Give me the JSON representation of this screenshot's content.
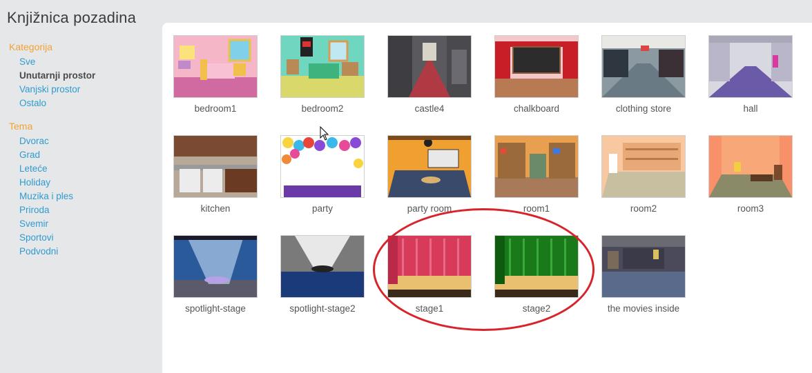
{
  "title": "Knjižnica pozadina",
  "sidebar": {
    "category_heading": "Kategorija",
    "categories": [
      {
        "label": "Sve",
        "active": false
      },
      {
        "label": "Unutarnji prostor",
        "active": true
      },
      {
        "label": "Vanjski prostor",
        "active": false
      },
      {
        "label": "Ostalo",
        "active": false
      }
    ],
    "theme_heading": "Tema",
    "themes": [
      {
        "label": "Dvorac"
      },
      {
        "label": "Grad"
      },
      {
        "label": "Leteće"
      },
      {
        "label": "Holiday"
      },
      {
        "label": "Muzika i ples"
      },
      {
        "label": "Priroda"
      },
      {
        "label": "Svemir"
      },
      {
        "label": "Sportovi"
      },
      {
        "label": "Podvodni"
      }
    ]
  },
  "backdrops": [
    {
      "name": "bedroom1",
      "icon": "bedroom1-thumbnail"
    },
    {
      "name": "bedroom2",
      "icon": "bedroom2-thumbnail"
    },
    {
      "name": "castle4",
      "icon": "castle4-thumbnail"
    },
    {
      "name": "chalkboard",
      "icon": "chalkboard-thumbnail"
    },
    {
      "name": "clothing store",
      "icon": "clothing-store-thumbnail"
    },
    {
      "name": "hall",
      "icon": "hall-thumbnail"
    },
    {
      "name": "kitchen",
      "icon": "kitchen-thumbnail"
    },
    {
      "name": "party",
      "icon": "party-thumbnail"
    },
    {
      "name": "party room",
      "icon": "party-room-thumbnail"
    },
    {
      "name": "room1",
      "icon": "room1-thumbnail"
    },
    {
      "name": "room2",
      "icon": "room2-thumbnail"
    },
    {
      "name": "room3",
      "icon": "room3-thumbnail"
    },
    {
      "name": "spotlight-stage",
      "icon": "spotlight-stage-thumbnail"
    },
    {
      "name": "spotlight-stage2",
      "icon": "spotlight-stage2-thumbnail"
    },
    {
      "name": "stage1",
      "icon": "stage1-thumbnail"
    },
    {
      "name": "stage2",
      "icon": "stage2-thumbnail"
    },
    {
      "name": "the movies inside",
      "icon": "movies-inside-thumbnail"
    }
  ],
  "annotation": {
    "highlighted": [
      "stage1",
      "stage2"
    ],
    "color": "#d8232a"
  },
  "colors": {
    "link": "#2e9bd1",
    "heading": "#f4a233",
    "active": "#4a4a4a"
  }
}
